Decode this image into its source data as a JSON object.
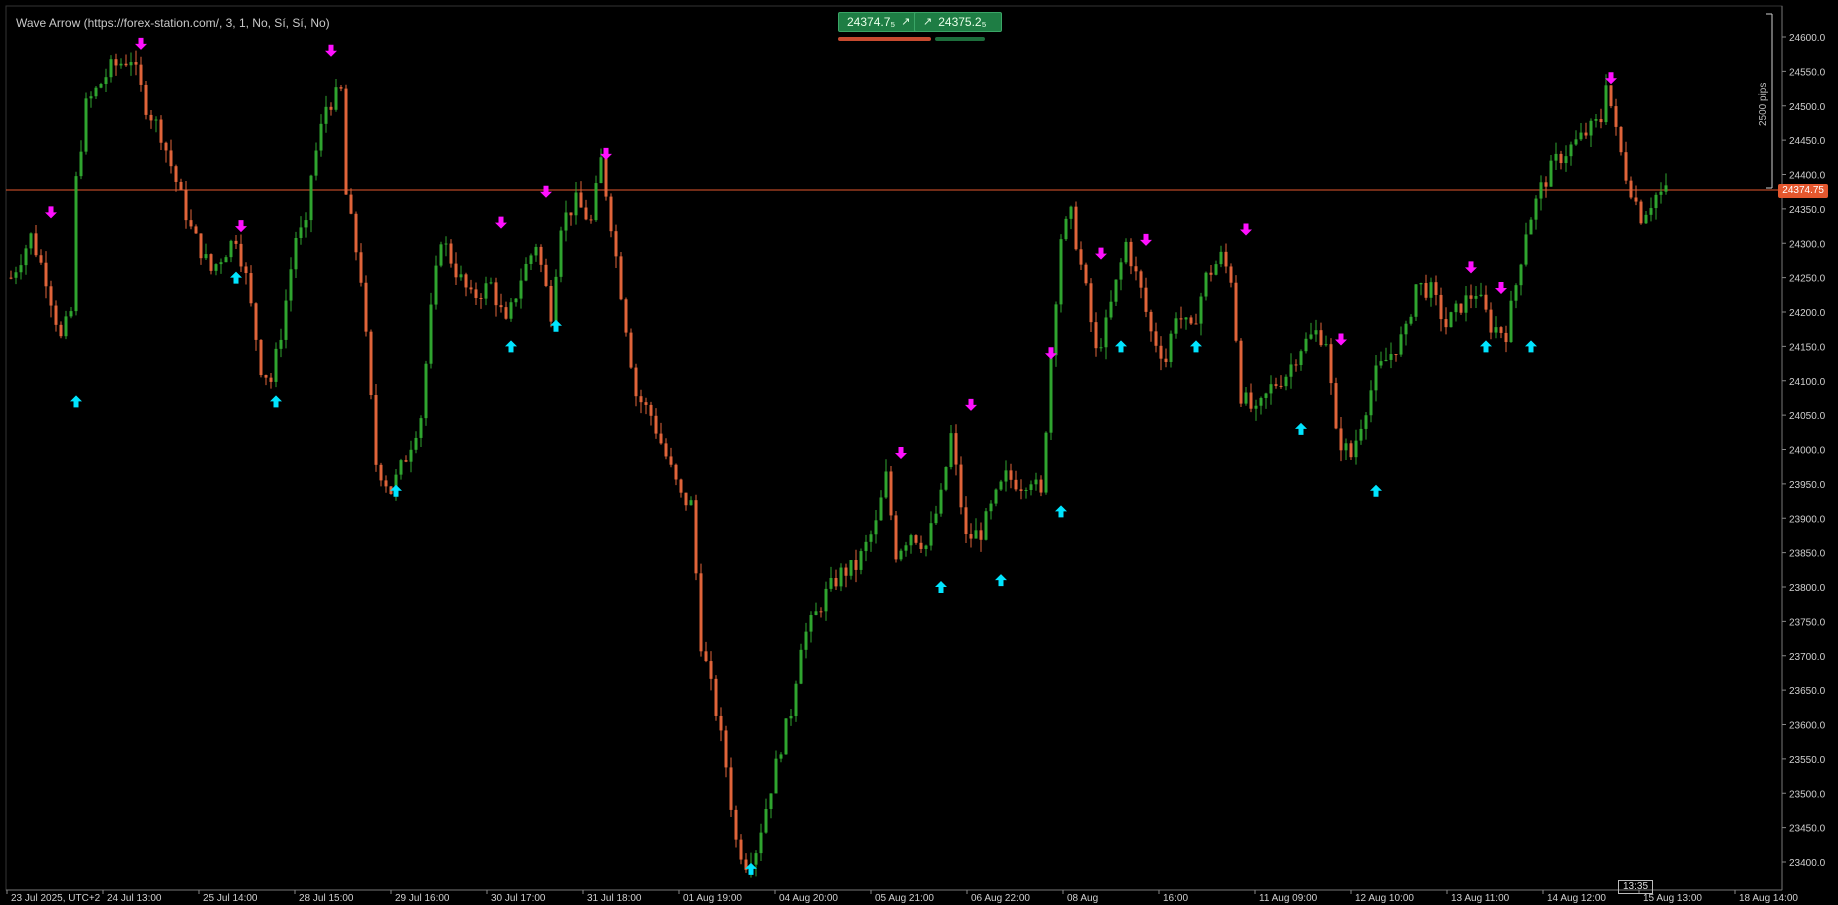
{
  "indicator": {
    "label": "Wave Arrow (https://forex-station.com/, 3, 1, No, Sí, Sí, No)"
  },
  "trade_panel": {
    "bid": "24374.7₅",
    "ask": "24375.2₅",
    "buy_icon": "arrow-up-right-icon"
  },
  "current_price": "24374.75",
  "scale_label": "2500 pips",
  "clock_label": "13:35",
  "colors": {
    "background": "#000000",
    "bull": "#2fa52f",
    "bear": "#e0643a",
    "buy_arrow": "#00e5ff",
    "sell_arrow": "#ff10ff",
    "price_line": "#e4572e"
  },
  "chart_data": {
    "type": "candlestick",
    "ylim": [
      23375,
      24625
    ],
    "y_ticks": [
      "24600.0",
      "24550.0",
      "24500.0",
      "24450.0",
      "24400.0",
      "24350.0",
      "24300.0",
      "24250.0",
      "24200.0",
      "24150.0",
      "24100.0",
      "24050.0",
      "24000.0",
      "23950.0",
      "23900.0",
      "23850.0",
      "23800.0",
      "23750.0",
      "23700.0",
      "23650.0",
      "23600.0",
      "23550.0",
      "23500.0",
      "23450.0",
      "23400.0"
    ],
    "x_ticks": [
      "23 Jul 2025, UTC+2",
      "24 Jul 13:00",
      "25 Jul 14:00",
      "28 Jul 15:00",
      "29 Jul 16:00",
      "30 Jul 17:00",
      "31 Jul 18:00",
      "01 Aug 19:00",
      "04 Aug 20:00",
      "05 Aug 21:00",
      "06 Aug 22:00",
      "08 Aug",
      "16:00",
      "11 Aug 09:00",
      "12 Aug 10:00",
      "13 Aug 11:00",
      "14 Aug 12:00",
      "15 Aug 13:00",
      "18 Aug 14:00"
    ],
    "price_path": [
      [
        0,
        24250
      ],
      [
        4,
        24310
      ],
      [
        7,
        24250
      ],
      [
        10,
        24160
      ],
      [
        12,
        24200
      ],
      [
        13,
        24390
      ],
      [
        15,
        24500
      ],
      [
        20,
        24555
      ],
      [
        24,
        24570
      ],
      [
        27,
        24500
      ],
      [
        30,
        24460
      ],
      [
        33,
        24390
      ],
      [
        36,
        24320
      ],
      [
        40,
        24260
      ],
      [
        43,
        24290
      ],
      [
        45,
        24310
      ],
      [
        47,
        24250
      ],
      [
        50,
        24120
      ],
      [
        52,
        24100
      ],
      [
        54,
        24170
      ],
      [
        57,
        24310
      ],
      [
        59,
        24320
      ],
      [
        60,
        24400
      ],
      [
        63,
        24500
      ],
      [
        66,
        24520
      ],
      [
        67,
        24370
      ],
      [
        70,
        24250
      ],
      [
        73,
        23980
      ],
      [
        76,
        23940
      ],
      [
        79,
        23990
      ],
      [
        82,
        24050
      ],
      [
        84,
        24200
      ],
      [
        86,
        24310
      ],
      [
        89,
        24260
      ],
      [
        92,
        24220
      ],
      [
        96,
        24240
      ],
      [
        99,
        24180
      ],
      [
        102,
        24250
      ],
      [
        105,
        24300
      ],
      [
        108,
        24200
      ],
      [
        110,
        24330
      ],
      [
        113,
        24360
      ],
      [
        116,
        24330
      ],
      [
        118,
        24420
      ],
      [
        120,
        24330
      ],
      [
        122,
        24230
      ],
      [
        125,
        24080
      ],
      [
        128,
        24050
      ],
      [
        131,
        23990
      ],
      [
        134,
        23930
      ],
      [
        136,
        23920
      ],
      [
        138,
        23720
      ],
      [
        141,
        23620
      ],
      [
        143,
        23540
      ],
      [
        145,
        23430
      ],
      [
        147,
        23400
      ],
      [
        149,
        23420
      ],
      [
        151,
        23480
      ],
      [
        154,
        23570
      ],
      [
        156,
        23620
      ],
      [
        158,
        23720
      ],
      [
        161,
        23760
      ],
      [
        163,
        23790
      ],
      [
        166,
        23820
      ],
      [
        169,
        23830
      ],
      [
        171,
        23860
      ],
      [
        173,
        23890
      ],
      [
        175,
        23960
      ],
      [
        177,
        23850
      ],
      [
        180,
        23880
      ],
      [
        183,
        23860
      ],
      [
        186,
        23930
      ],
      [
        188,
        24020
      ],
      [
        191,
        23870
      ],
      [
        194,
        23880
      ],
      [
        197,
        23930
      ],
      [
        199,
        23960
      ],
      [
        202,
        23950
      ],
      [
        204,
        23960
      ],
      [
        206,
        23930
      ],
      [
        208,
        24140
      ],
      [
        210,
        24310
      ],
      [
        212,
        24340
      ],
      [
        215,
        24230
      ],
      [
        217,
        24140
      ],
      [
        219,
        24180
      ],
      [
        221,
        24240
      ],
      [
        223,
        24300
      ],
      [
        226,
        24230
      ],
      [
        228,
        24170
      ],
      [
        231,
        24130
      ],
      [
        233,
        24200
      ],
      [
        236,
        24170
      ],
      [
        239,
        24250
      ],
      [
        242,
        24280
      ],
      [
        244,
        24250
      ],
      [
        246,
        24080
      ],
      [
        249,
        24050
      ],
      [
        252,
        24090
      ],
      [
        255,
        24110
      ],
      [
        258,
        24150
      ],
      [
        261,
        24170
      ],
      [
        263,
        24160
      ],
      [
        265,
        24020
      ],
      [
        268,
        23990
      ],
      [
        270,
        24040
      ],
      [
        273,
        24110
      ],
      [
        276,
        24140
      ],
      [
        279,
        24170
      ],
      [
        281,
        24240
      ],
      [
        284,
        24230
      ],
      [
        287,
        24180
      ],
      [
        290,
        24210
      ],
      [
        293,
        24230
      ],
      [
        296,
        24180
      ],
      [
        299,
        24170
      ],
      [
        301,
        24240
      ],
      [
        303,
        24320
      ],
      [
        306,
        24380
      ],
      [
        309,
        24420
      ],
      [
        312,
        24440
      ],
      [
        315,
        24460
      ],
      [
        318,
        24480
      ],
      [
        319,
        24540
      ],
      [
        321,
        24460
      ],
      [
        323,
        24400
      ],
      [
        326,
        24340
      ],
      [
        329,
        24370
      ],
      [
        331,
        24375
      ]
    ],
    "buy_signals": [
      [
        13,
        24070
      ],
      [
        45,
        24250
      ],
      [
        53,
        24070
      ],
      [
        77,
        23940
      ],
      [
        100,
        24150
      ],
      [
        109,
        24180
      ],
      [
        148,
        23390
      ],
      [
        186,
        23800
      ],
      [
        198,
        23810
      ],
      [
        210,
        23910
      ],
      [
        222,
        24150
      ],
      [
        237,
        24150
      ],
      [
        258,
        24030
      ],
      [
        273,
        23940
      ],
      [
        295,
        24150
      ],
      [
        304,
        24150
      ]
    ],
    "sell_signals": [
      [
        8,
        24345
      ],
      [
        26,
        24590
      ],
      [
        46,
        24325
      ],
      [
        64,
        24580
      ],
      [
        98,
        24330
      ],
      [
        107,
        24375
      ],
      [
        119,
        24430
      ],
      [
        178,
        23995
      ],
      [
        192,
        24065
      ],
      [
        208,
        24140
      ],
      [
        218,
        24285
      ],
      [
        227,
        24305
      ],
      [
        247,
        24320
      ],
      [
        266,
        24160
      ],
      [
        292,
        24265
      ],
      [
        298,
        24235
      ],
      [
        320,
        24540
      ]
    ]
  }
}
